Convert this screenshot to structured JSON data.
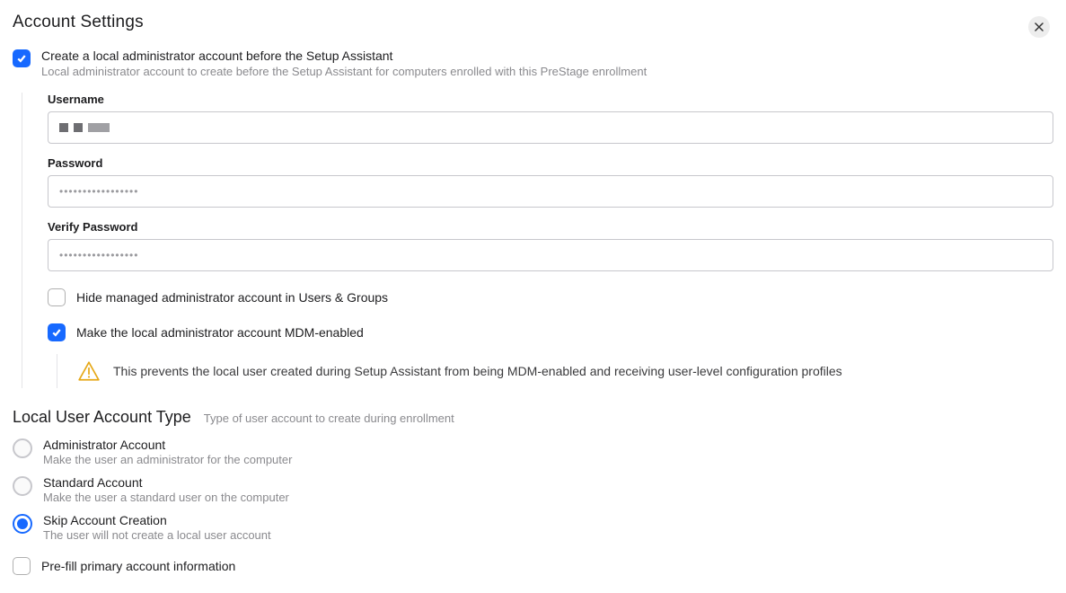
{
  "header": {
    "title": "Account Settings"
  },
  "create_admin": {
    "checked": true,
    "label": "Create a local administrator account before the Setup Assistant",
    "desc": "Local administrator account to create before the Setup Assistant for computers enrolled with this PreStage enrollment",
    "fields": {
      "username_label": "Username",
      "username_value": "",
      "password_label": "Password",
      "password_value": "•••••••••••••••••",
      "verify_label": "Verify Password",
      "verify_value": "•••••••••••••••••"
    },
    "hide_managed": {
      "checked": false,
      "label": "Hide managed administrator account in Users & Groups"
    },
    "mdm_enabled": {
      "checked": true,
      "label": "Make the local administrator account MDM-enabled",
      "warning": "This prevents the local user created during Setup Assistant from being MDM-enabled and receiving user-level configuration profiles"
    }
  },
  "account_type": {
    "title": "Local User Account Type",
    "desc": "Type of user account to create during enrollment",
    "options": {
      "admin": {
        "label": "Administrator Account",
        "desc": "Make the user an administrator for the computer"
      },
      "standard": {
        "label": "Standard Account",
        "desc": "Make the user a standard user on the computer"
      },
      "skip": {
        "label": "Skip Account Creation",
        "desc": "The user will not create a local user account"
      }
    },
    "selected": "skip"
  },
  "prefill": {
    "checked": false,
    "label": "Pre-fill primary account information"
  }
}
